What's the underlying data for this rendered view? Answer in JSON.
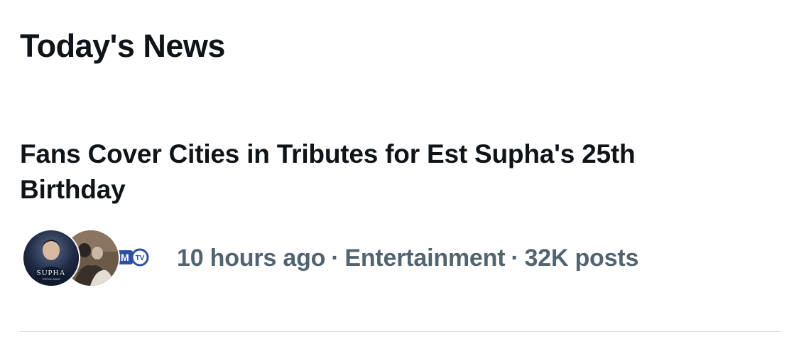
{
  "section": {
    "title": "Today's News"
  },
  "news_item": {
    "headline": "Fans Cover Cities in Tributes for Est Supha's 25th Birthday",
    "time": "10 hours ago",
    "separator": "·",
    "category": "Entertainment",
    "posts": "32K posts",
    "avatars": [
      {
        "icon": "supha-trend-wave-avatar",
        "text": "SUPHA",
        "subtext": "TREND WAVE"
      },
      {
        "icon": "group-photo-avatar"
      },
      {
        "icon": "mmtv-logo-avatar",
        "text": "MM",
        "subtext": "TV"
      }
    ]
  },
  "colors": {
    "text_primary": "#0f1419",
    "text_secondary": "#536471",
    "divider": "#cfd9de",
    "mmtv_blue": "#2d4fa0"
  }
}
